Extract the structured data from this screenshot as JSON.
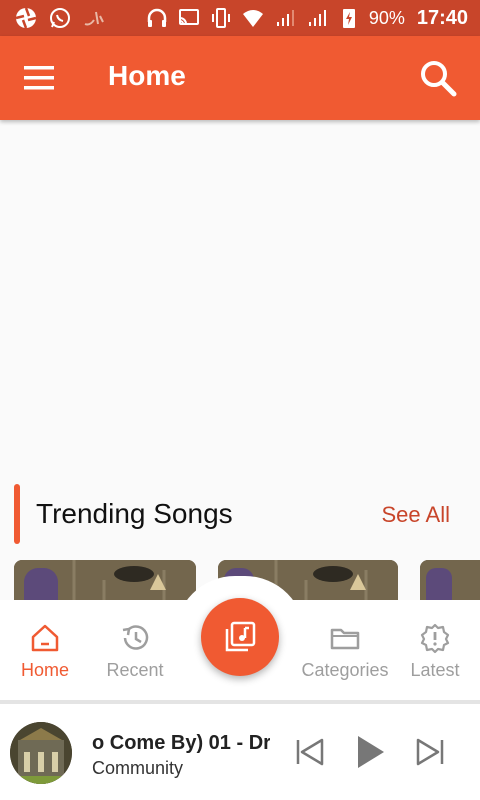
{
  "status_bar": {
    "battery": "90%",
    "time": "17:40",
    "icons": [
      "aperture-icon",
      "whatsapp-icon",
      "arabic-app-icon",
      "headphones-icon",
      "cast-icon",
      "vibrate-icon",
      "wifi-icon",
      "signal-icon",
      "signal-icon",
      "battery-charging-icon"
    ]
  },
  "app_bar": {
    "title": "Home",
    "menu_icon": "hamburger-icon",
    "search_icon": "search-icon"
  },
  "trending": {
    "title": "Trending Songs",
    "see_all": "See All"
  },
  "bottom_nav": {
    "items": [
      {
        "label": "Home",
        "icon": "home-icon",
        "active": true
      },
      {
        "label": "Recent",
        "icon": "history-icon",
        "active": false
      },
      {
        "label": "Categories",
        "icon": "folder-icon",
        "active": false
      },
      {
        "label": "Latest",
        "icon": "alert-badge-icon",
        "active": false
      }
    ],
    "fab_icon": "music-library-icon"
  },
  "player": {
    "title": "o Come By) 01 - Dr",
    "artist": "Community",
    "controls": [
      "skip-previous-icon",
      "play-icon",
      "skip-next-icon"
    ]
  },
  "colors": {
    "primary": "#f05a32",
    "status_bar": "#c8452a",
    "inactive": "#9e9e9e"
  }
}
